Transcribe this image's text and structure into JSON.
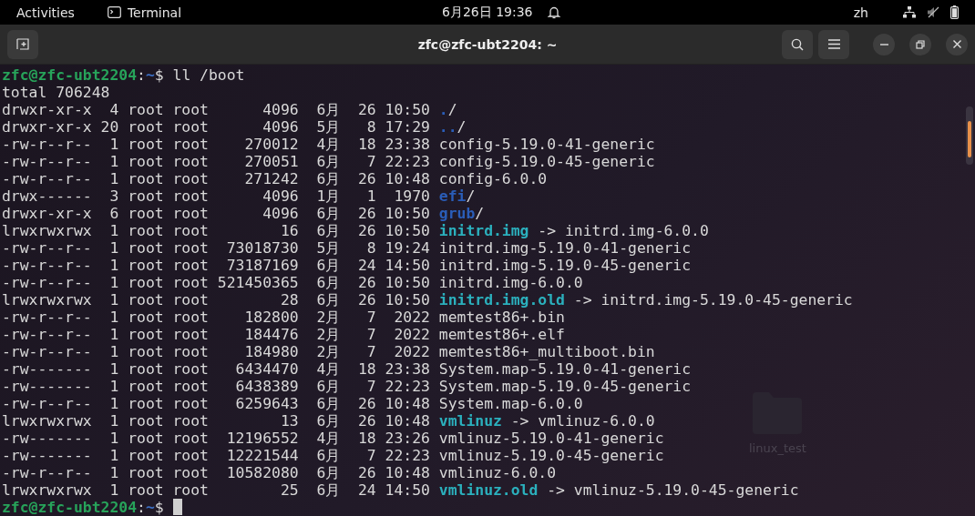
{
  "top_bar": {
    "activities": "Activities",
    "app": "Terminal",
    "clock": "6月26日  19:36",
    "input_method": "zh"
  },
  "window": {
    "title": "zfc@zfc-ubt2204: ~"
  },
  "desktop": {
    "icons": [
      {
        "label": "linux_test"
      }
    ]
  },
  "terminal": {
    "lines": [
      {
        "kind": "prompt",
        "user_host": "zfc@zfc-ubt2204",
        "separator": ":",
        "path": "~",
        "symbol": "$",
        "command": "ll /boot",
        "cursor": false
      },
      {
        "kind": "text",
        "text": "total 706248"
      },
      {
        "kind": "dir",
        "meta": "drwxr-xr-x  4 root root      4096  6月  26 10:50",
        "name": ".",
        "suffix": "/"
      },
      {
        "kind": "dir",
        "meta": "drwxr-xr-x 20 root root      4096  5月   8 17:29",
        "name": "..",
        "suffix": "/"
      },
      {
        "kind": "file",
        "meta": "-rw-r--r--  1 root root    270012  4月  18 23:38",
        "name": "config-5.19.0-41-generic"
      },
      {
        "kind": "file",
        "meta": "-rw-r--r--  1 root root    270051  6月   7 22:23",
        "name": "config-5.19.0-45-generic"
      },
      {
        "kind": "file",
        "meta": "-rw-r--r--  1 root root    271242  6月  26 10:48",
        "name": "config-6.0.0"
      },
      {
        "kind": "dir",
        "meta": "drwx------  3 root root      4096  1月   1  1970",
        "name": "efi",
        "suffix": "/"
      },
      {
        "kind": "dir",
        "meta": "drwxr-xr-x  6 root root      4096  6月  26 10:50",
        "name": "grub",
        "suffix": "/"
      },
      {
        "kind": "link",
        "meta": "lrwxrwxrwx  1 root root        16  6月  26 10:50",
        "name": "initrd.img",
        "target": "-> initrd.img-6.0.0"
      },
      {
        "kind": "file",
        "meta": "-rw-r--r--  1 root root  73018730  5月   8 19:24",
        "name": "initrd.img-5.19.0-41-generic"
      },
      {
        "kind": "file",
        "meta": "-rw-r--r--  1 root root  73187169  6月  24 14:50",
        "name": "initrd.img-5.19.0-45-generic"
      },
      {
        "kind": "file",
        "meta": "-rw-r--r--  1 root root 521450365  6月  26 10:50",
        "name": "initrd.img-6.0.0"
      },
      {
        "kind": "link",
        "meta": "lrwxrwxrwx  1 root root        28  6月  26 10:50",
        "name": "initrd.img.old",
        "target": "-> initrd.img-5.19.0-45-generic"
      },
      {
        "kind": "file",
        "meta": "-rw-r--r--  1 root root    182800  2月   7  2022",
        "name": "memtest86+.bin"
      },
      {
        "kind": "file",
        "meta": "-rw-r--r--  1 root root    184476  2月   7  2022",
        "name": "memtest86+.elf"
      },
      {
        "kind": "file",
        "meta": "-rw-r--r--  1 root root    184980  2月   7  2022",
        "name": "memtest86+_multiboot.bin"
      },
      {
        "kind": "file",
        "meta": "-rw-------  1 root root   6434470  4月  18 23:38",
        "name": "System.map-5.19.0-41-generic"
      },
      {
        "kind": "file",
        "meta": "-rw-------  1 root root   6438389  6月   7 22:23",
        "name": "System.map-5.19.0-45-generic"
      },
      {
        "kind": "file",
        "meta": "-rw-r--r--  1 root root   6259643  6月  26 10:48",
        "name": "System.map-6.0.0"
      },
      {
        "kind": "link",
        "meta": "lrwxrwxrwx  1 root root        13  6月  26 10:48",
        "name": "vmlinuz",
        "target": "-> vmlinuz-6.0.0"
      },
      {
        "kind": "file",
        "meta": "-rw-------  1 root root  12196552  4月  18 23:26",
        "name": "vmlinuz-5.19.0-41-generic"
      },
      {
        "kind": "file",
        "meta": "-rw-------  1 root root  12221544  6月   7 22:23",
        "name": "vmlinuz-5.19.0-45-generic"
      },
      {
        "kind": "file",
        "meta": "-rw-r--r--  1 root root  10582080  6月  26 10:48",
        "name": "vmlinuz-6.0.0"
      },
      {
        "kind": "link",
        "meta": "lrwxrwxrwx  1 root root        25  6月  24 14:50",
        "name": "vmlinuz.old",
        "target": "-> vmlinuz-5.19.0-45-generic"
      },
      {
        "kind": "prompt",
        "user_host": "zfc@zfc-ubt2204",
        "separator": ":",
        "path": "~",
        "symbol": "$",
        "cursor": true
      }
    ]
  }
}
